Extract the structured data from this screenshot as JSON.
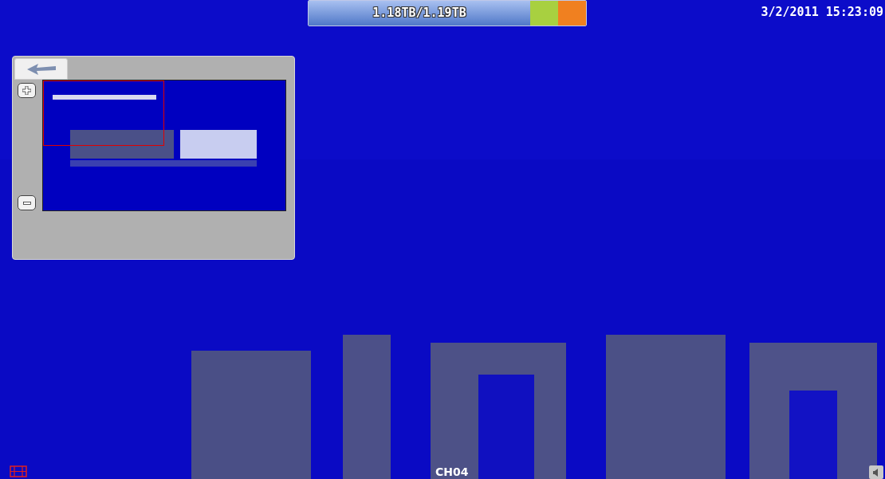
{
  "storage": {
    "text": "1.18TB/1.19TB",
    "level": 0.8
  },
  "clock": "3/2/2011 15:23:09",
  "channel": "CH04"
}
